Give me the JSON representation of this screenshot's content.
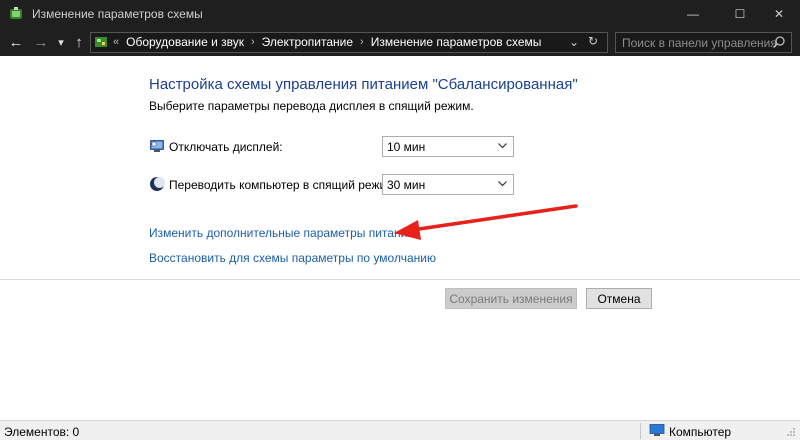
{
  "window": {
    "title": "Изменение параметров схемы",
    "controls": {
      "minimize": "—",
      "maximize": "☐",
      "close": "✕"
    }
  },
  "nav": {
    "back": "←",
    "forward": "→",
    "recent": "▾",
    "up": "↑",
    "breadcrumb": [
      {
        "label": "Оборудование и звук"
      },
      {
        "label": "Электропитание"
      },
      {
        "label": "Изменение параметров схемы"
      }
    ],
    "crumb_sep": "›",
    "lead_sep": "«",
    "dropdown": "⌄",
    "refresh": "↻",
    "search_placeholder": "Поиск в панели управления"
  },
  "main": {
    "heading": "Настройка схемы управления питанием \"Сбалансированная\"",
    "subheading": "Выберите параметры перевода дисплея в спящий режим.",
    "settings": [
      {
        "label": "Отключать дисплей:",
        "value": "10 мин",
        "icon": "display-icon"
      },
      {
        "label": "Переводить компьютер в спящий режим:",
        "value": "30 мин",
        "icon": "sleep-moon-icon"
      }
    ],
    "links": {
      "advanced": "Изменить дополнительные параметры питания",
      "restore": "Восстановить для схемы параметры по умолчанию"
    },
    "buttons": {
      "save": "Сохранить изменения",
      "cancel": "Отмена"
    }
  },
  "status": {
    "items": "Элементов: 0",
    "location": "Компьютер"
  },
  "colors": {
    "titlebar": "#1f1f1f",
    "heading": "#1c3f94",
    "link": "#1c5ea8",
    "annotation_arrow": "#e8221b"
  }
}
